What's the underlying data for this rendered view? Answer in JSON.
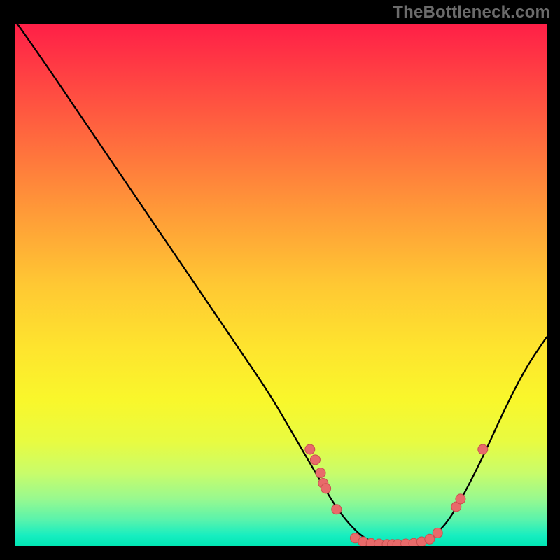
{
  "attribution": "TheBottleneck.com",
  "colors": {
    "dot_fill": "#e86a6a",
    "dot_stroke": "#c94f4f",
    "curve_stroke": "#000000"
  },
  "chart_data": {
    "type": "line",
    "title": "",
    "xlabel": "",
    "ylabel": "",
    "xlim": [
      0,
      100
    ],
    "ylim": [
      0,
      100
    ],
    "curve_points": [
      {
        "x": 0.5,
        "y": 100
      },
      {
        "x": 6,
        "y": 92
      },
      {
        "x": 12,
        "y": 83
      },
      {
        "x": 18,
        "y": 74
      },
      {
        "x": 24,
        "y": 65
      },
      {
        "x": 30,
        "y": 56
      },
      {
        "x": 36,
        "y": 47
      },
      {
        "x": 42,
        "y": 38
      },
      {
        "x": 48,
        "y": 29
      },
      {
        "x": 52,
        "y": 22
      },
      {
        "x": 56,
        "y": 15
      },
      {
        "x": 60,
        "y": 8
      },
      {
        "x": 63,
        "y": 4
      },
      {
        "x": 66,
        "y": 1.2
      },
      {
        "x": 69,
        "y": 0.4
      },
      {
        "x": 72,
        "y": 0.2
      },
      {
        "x": 75,
        "y": 0.4
      },
      {
        "x": 78,
        "y": 1.4
      },
      {
        "x": 81,
        "y": 4
      },
      {
        "x": 84,
        "y": 9
      },
      {
        "x": 88,
        "y": 17
      },
      {
        "x": 92,
        "y": 26
      },
      {
        "x": 96,
        "y": 34
      },
      {
        "x": 100,
        "y": 40
      }
    ],
    "data_points": [
      {
        "x": 55.5,
        "y": 18.5
      },
      {
        "x": 56.5,
        "y": 16.5
      },
      {
        "x": 57.5,
        "y": 14.0
      },
      {
        "x": 58.0,
        "y": 12.0
      },
      {
        "x": 58.5,
        "y": 11.0
      },
      {
        "x": 60.5,
        "y": 7.0
      },
      {
        "x": 64.0,
        "y": 1.5
      },
      {
        "x": 65.5,
        "y": 0.8
      },
      {
        "x": 67.0,
        "y": 0.5
      },
      {
        "x": 68.5,
        "y": 0.4
      },
      {
        "x": 70.0,
        "y": 0.3
      },
      {
        "x": 71.0,
        "y": 0.3
      },
      {
        "x": 72.0,
        "y": 0.3
      },
      {
        "x": 73.5,
        "y": 0.4
      },
      {
        "x": 75.0,
        "y": 0.5
      },
      {
        "x": 76.5,
        "y": 0.8
      },
      {
        "x": 78.0,
        "y": 1.3
      },
      {
        "x": 79.5,
        "y": 2.5
      },
      {
        "x": 83.0,
        "y": 7.5
      },
      {
        "x": 83.8,
        "y": 9.0
      },
      {
        "x": 88.0,
        "y": 18.5
      }
    ]
  }
}
